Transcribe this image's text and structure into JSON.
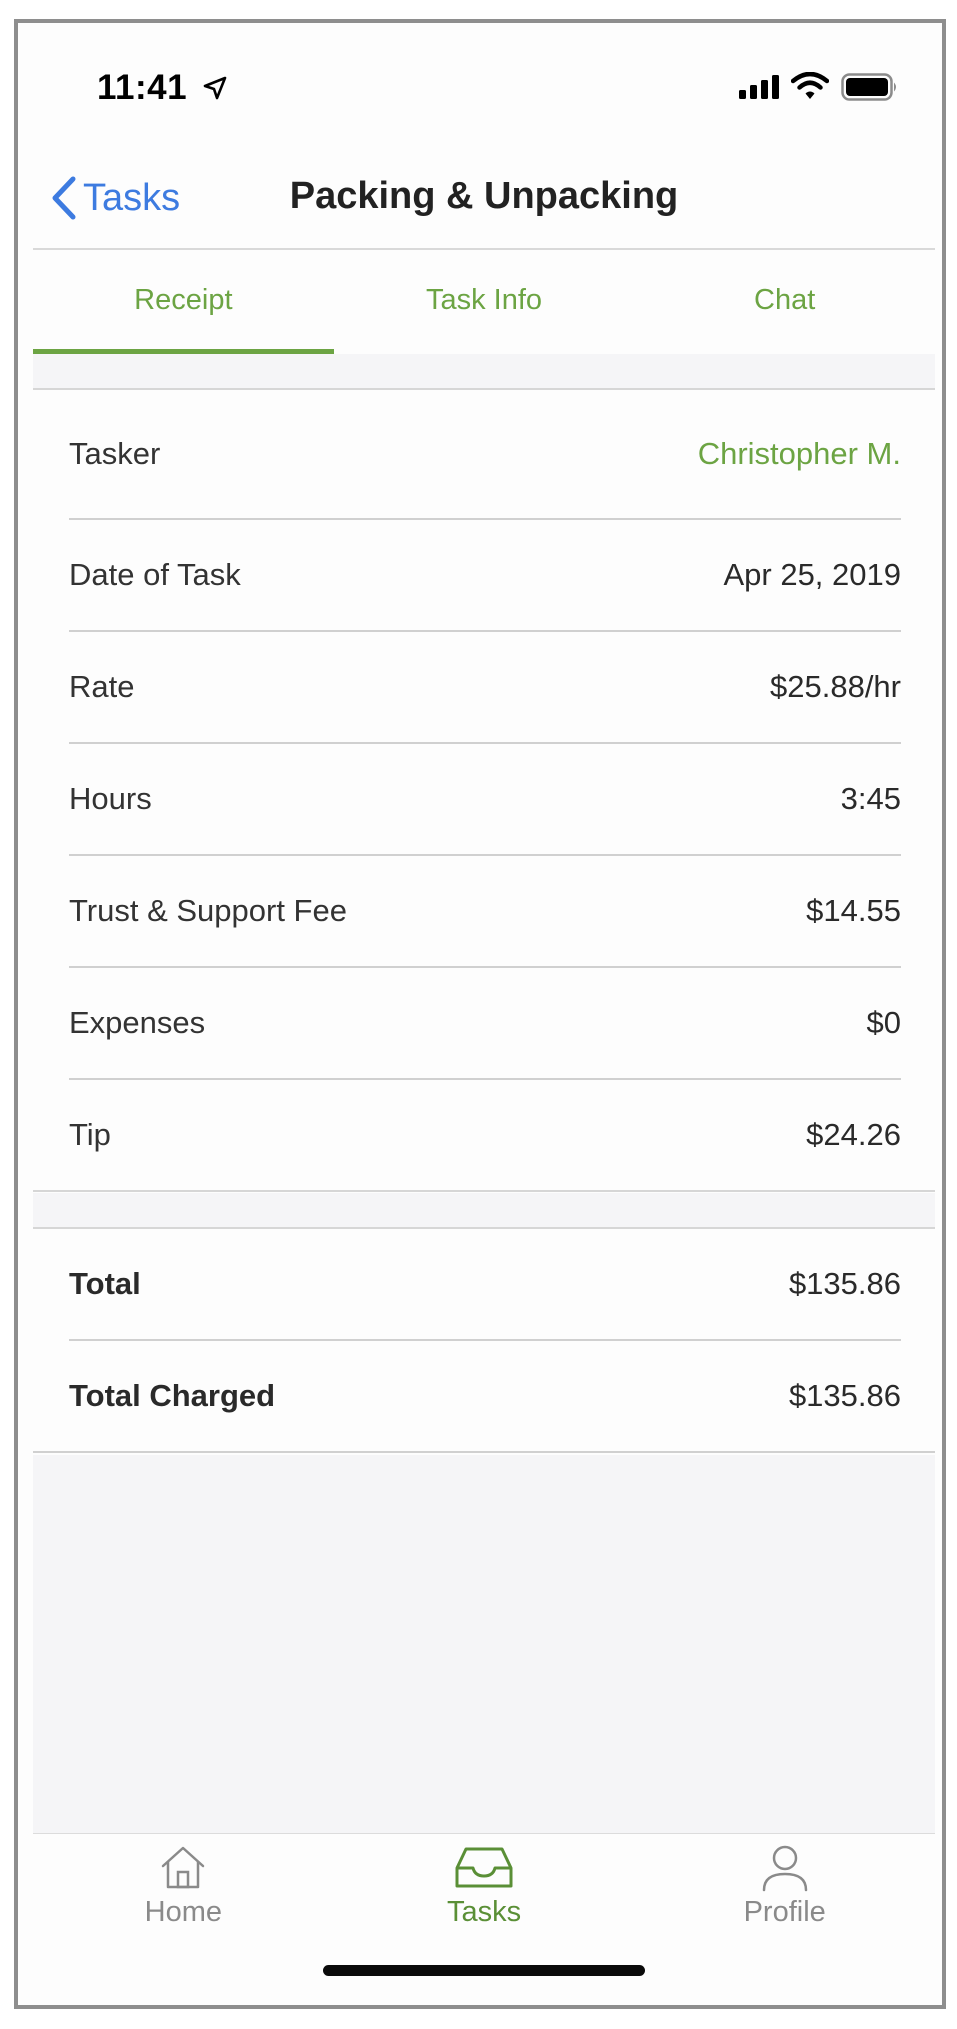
{
  "status_bar": {
    "time": "11:41"
  },
  "nav": {
    "back_label": "Tasks",
    "title": "Packing & Unpacking"
  },
  "tabs": [
    {
      "label": "Receipt",
      "active": true
    },
    {
      "label": "Task Info",
      "active": false
    },
    {
      "label": "Chat",
      "active": false
    }
  ],
  "receipt": {
    "tasker": {
      "label": "Tasker",
      "value": "Christopher M."
    },
    "date": {
      "label": "Date of Task",
      "value": "Apr 25, 2019"
    },
    "rate": {
      "label": "Rate",
      "value": "$25.88/hr"
    },
    "hours": {
      "label": "Hours",
      "value": "3:45"
    },
    "fee": {
      "label": "Trust & Support Fee",
      "value": "$14.55"
    },
    "expenses": {
      "label": "Expenses",
      "value": "$0"
    },
    "tip": {
      "label": "Tip",
      "value": "$24.26"
    }
  },
  "totals": {
    "total": {
      "label": "Total",
      "value": "$135.86"
    },
    "total_charged": {
      "label": "Total Charged",
      "value": "$135.86"
    }
  },
  "tab_bar": {
    "home": {
      "label": "Home",
      "icon": "house-icon"
    },
    "tasks": {
      "label": "Tasks",
      "icon": "inbox-tray-icon"
    },
    "profile": {
      "label": "Profile",
      "icon": "person-icon"
    }
  },
  "colors": {
    "accent": "#6ca443",
    "link_blue": "#3d7be0",
    "background": "#fdfdfd",
    "separator": "#f5f5f7"
  }
}
